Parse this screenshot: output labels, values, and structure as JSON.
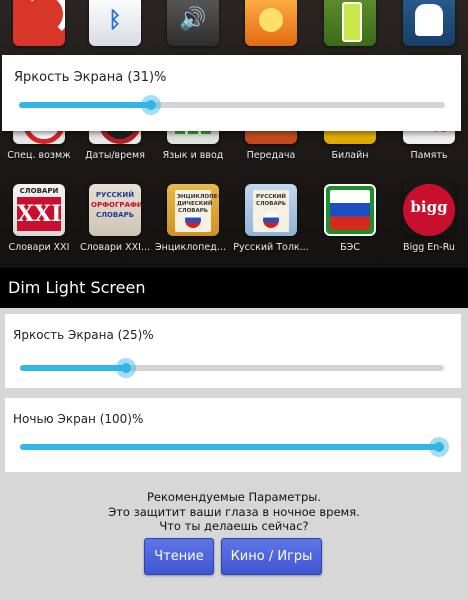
{
  "launcher": {
    "top_row": [
      {
        "name": "rss",
        "glyph": ""
      },
      {
        "name": "bluetooth",
        "glyph": "ᛒ"
      },
      {
        "name": "volume",
        "glyph": "🔊"
      },
      {
        "name": "display",
        "glyph": ""
      },
      {
        "name": "battery",
        "glyph": ""
      },
      {
        "name": "android",
        "glyph": ""
      }
    ],
    "apps_row2": [
      {
        "label": "Спец. возмж"
      },
      {
        "label": "Даты/время"
      },
      {
        "label": "Язык и ввод"
      },
      {
        "label": "Передача"
      },
      {
        "label": "Билайн"
      },
      {
        "label": "Память",
        "glyph": "%"
      }
    ],
    "apps_row3": [
      {
        "label": "Словари XXI",
        "icon_title": "СЛОВАРИ",
        "icon_text": "XXI"
      },
      {
        "label": "Словари XXI...",
        "icon_title": "РУССКИЙ",
        "icon_sub": "ОРФОГРАФИЧЕСКИЙ",
        "icon_sub2": "СЛОВАРЬ"
      },
      {
        "label": "Энциклопеди...",
        "icon_text": "ЭНЦИКЛОПЕ-ДИЧЕСКИЙ СЛОВАРЬ"
      },
      {
        "label": "Русский Толк...",
        "icon_text": "РУССКИЙ СЛОВАРЬ"
      },
      {
        "label": "БЭС"
      },
      {
        "label": "Bigg En-Ru",
        "icon_text": "bigg"
      }
    ],
    "overlay": {
      "label": "Яркость Экрана  (31)%",
      "value": 31
    }
  },
  "app": {
    "title": "Dim Light Screen",
    "brightness": {
      "label": "Яркость Экрана  (25)%",
      "value": 25
    },
    "night": {
      "label": "Ночью Экран  (100)%",
      "value": 100
    },
    "recommend": [
      "Рекомендуемые Параметры.",
      "Это защитит ваши глаза в ночное время.",
      "Что ты делаешь сейчас?"
    ],
    "buttons": {
      "read": "Чтение",
      "movies": "Кино / Игры"
    }
  },
  "colors": {
    "accent": "#33b5e5",
    "button": "#4a62dc",
    "background": "#d7d7d7"
  }
}
